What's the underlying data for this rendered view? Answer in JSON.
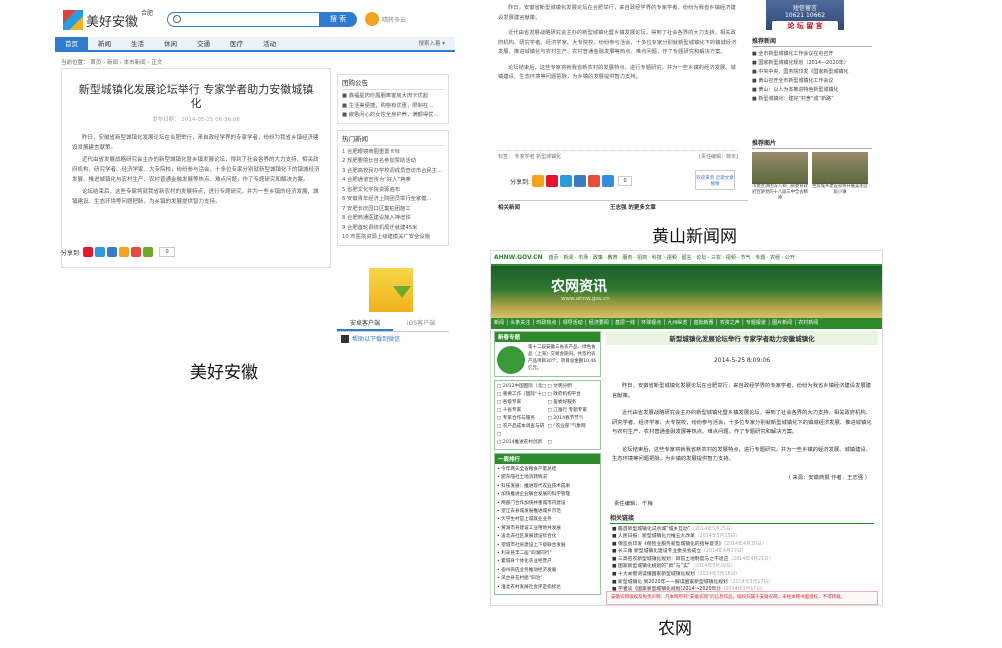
{
  "captions": {
    "meihao": "美好安徽",
    "huangshan": "黄山新闻网",
    "nongwang": "农网"
  },
  "meihao": {
    "logo": "美好安徽",
    "city": "合肥",
    "search_button": "搜 索",
    "weather": "晴转多云",
    "nav": [
      "首页",
      "新闻",
      "生活",
      "休闲",
      "交通",
      "医疗",
      "活动"
    ],
    "nav_right": "搜索入着 ▾",
    "breadcrumb": "当前位置： 首页 › 新闻 › 本市新闻 › 正文",
    "title": "新型城镇化发展论坛举行 专家学者助力安徽城镇化",
    "date": "发布日期： 2014-05-25 06:36:08",
    "paragraphs": [
      "昨日，安徽省新型城镇化发展论坛在合肥举行，来自政经学界的专家学者，纷纷为我省乡镇经济建设发展建言献策。",
      "近代由省发展战略研究会主办的新型城镇化暨乡镇发展论坛，得到了社会各界的大力支持，相关政府机构、研究学者、经济学家、大专院校，纷纷参与活会，十多位专家分别就新型城镇化下的镇城经济发展、推进城镇化与农村生产、农村普通金融发展等热点、难点问题，作了专题研究和解决方案。",
      "论坛结束后，这些专家将就我省新农村的发展特点，进行专题研究，并为一些乡镇的经济发展、城镇建设、生态环境等问题把脉，为乡镇的发展提供智力支持。"
    ],
    "share_label": "分享到:",
    "share_count": "0",
    "notice_title": "团购公告",
    "notices": [
      "■ 鑫福星肉价露胭离客房大肉卡优起",
      "■ 生活美便捷，购物有优惠，限制在...",
      "■ 疲惫闲心的女性全身护养，满额得优..."
    ],
    "hot_title": "热门新闻",
    "hot": [
      "1 合肥眼镜商圈重置卡标",
      "2 规肥要院长自名参加赞助活动",
      "3 合肥高校民办学校调成员查访市合民主...",
      "4 合肥通道宣传为“好人”蒋拳",
      "5 省肥文化学院资源遍布",
      "6 安徽青年经济上院团员举行全家健...",
      "7 安肥长庆园口区集拍团施工",
      "8 合肥商通医建设施入神增铁",
      "9 合肥首轮县统机局迁就建45米",
      "10 市医院资源上级建模关广安全设施"
    ],
    "tabs": [
      "安卓客户端",
      "iOS客户端"
    ],
    "download": "帮助以下载到微信"
  },
  "huangshan": {
    "paragraphs": [
      "昨日，安徽省新型城镇化发展论坛在合肥举行，来自政经学界的专家学者，纷纷为我省乡镇经济建设发展建言献策。",
      "近代由省发展战略研究会主办的新型城镇化暨乡镇发展论坛，得到了社会各界的大力支持，相关政府机构、研究学者、经济学家、大专院校，纷纷参与活会，十多位专家分别就新型城镇化下的镇城经济发展、推进城镇化与农村生产、农村普通金融发展等热点、难点问题，作了专题研究和解决方案。",
      "论坛结束后，这些专家将就我省新农村的发展特点，进行专题研究，并为一些乡镇的经济发展、城镇建设、生态环境等问题把脉，为乡镇的发展提供智力支持。"
    ],
    "tags": "标签： 专家学者 新型城镇化",
    "editor": "[责任编辑：荷米]",
    "share_label": "分享到:",
    "share_count": "0",
    "ad": "欢迎来到\n近期文章搜精",
    "related": "相关新闻",
    "more": "王志强 的更多文章",
    "msg_top": "短信留言",
    "msg_num": "10621 10662",
    "msg_btn": "论 坛 留 言",
    "rec_title": "推荐新闻",
    "rec": [
      "■ 全市新型城镇化工作会议在屯召开",
      "■ 国家新型城镇化规划（2014—2020年）",
      "■ 中央中央、国务院印发《国家新型城镇化",
      "■ 黄山召开全市新型城镇化工作会议",
      "■ 黄山：以人为本推进特色新型城镇化",
      "■ 新型城镇化：建好“村舍”成“新路”"
    ],
    "pic_title": "推荐图片",
    "pic_caps": [
      "市委宣讲团深入祁门县委县政府宣讲党的十八届三中全会精神",
      "住房城乡建设部将开展美丽宜居小镇"
    ]
  },
  "nongwang": {
    "site": "AHNW.GOV.CN",
    "top_links": "首页 · 新闻 · 市场 · 政策 · 教育 · 服务 · 招商 · 科技 · 视频 · 留言 · 论坛 · 三农 · 视频 · 节气 · 专题 · 农经 · 公开",
    "banner_title": "农网资讯",
    "banner_url": "www.ahnw.gov.cn",
    "nav": "新闻 │ 头条关注 │ 时政热点 │ 领导活动 │ 经济要闻 │ 基层一线 │ 环球视点 │ 九州纵览 │ 首批新惠 │ 农资之声 │ 专题报道 │ 图片新闻 │ 农村新闻",
    "left_box_title": "新春专题",
    "left_box_text": "第十二届安徽三省农产品、绿色食品（上海）交易会期间，共签约农产品项目30个，项目总金额10.46亿元。",
    "grid": [
      "□ 2012中国国际（北□",
      "□ 文明分明",
      "□ 重要工作（国际“十□",
      "□ 政府机构平台",
      "□ 各级专家",
      "□ 居委好服务",
      "□ 十省专家",
      "□ 江淮行 专题专家",
      "□ 专家合作与服务",
      "□ 2014春节节气",
      "□ 农产品成本调查与研□",
      "□ “农业部”气象网",
      "□ 2014推进农村创新",
      "□ "
    ],
    "rank_title": "一周排行",
    "rank": [
      "• 今年两天全省粮食产量总结",
      "• 肥东隔社土地流转情况",
      "• 科技发展：推进现代农业技术成果",
      "• 加快推进企业联合发展的科学管理",
      "• 两部门合作加快并重城市内建设",
      "• 望江去县城发展推进城乡示范",
      "• 大学生村官上城就业业务",
      "• 黄湖市县建设工业用地共发展",
      "• 凌北去社区发展建设综合化",
      "• 望城市社县建设上下级联合发展",
      "• 利辛县丰二届“四湖同行”",
      "• 霍城县个体化农业经营户",
      "• 宿州商店业务推动经济发展",
      "• 凤台县在村组“四治”",
      "• 淮北农村发展社会评定指标达"
    ],
    "title": "新型城镇化发展论坛举行 专家学者助力安徽城镇化",
    "date": "2014-5-25 8:09:06",
    "paragraphs": [
      "昨日，安徽省新型城镇化发展论坛在合肥举行，来自政经学界的专家学者，纷纷为我省乡镇经济建设发展建言献策。",
      "近代由省发展战略研究会主办的新型城镇化暨乡镇发展论坛，得到了社会各界的大力支持，相关政府机构、研究学者、经济学家、大专院校，纷纷参与活会，十多位专家分别就新型城镇化下的镇城经济发展、推进城镇化与农村生产、农村普通金融发展等热点、难点问题，作了专题研究和解决方案。",
      "论坛结束后，这些专家将就我省新农村的发展特点，进行专题研究，并为一些乡镇的经济发展、城镇建设、生态环境等问题把脉，为乡镇的发展提供智力支持。"
    ],
    "source": "（ 来源：安徽商报  作者：王志强 ）",
    "editor": "责任编辑： 千梅",
    "links_title": "相关链接",
    "links": [
      "■ 瞻首新型城镇化试点城“城乡互动”",
      "■ 人民日报：新型城镇化力推五大改革",
      "■ 保监会印发《保险业服务新型城镇化的指导意见》",
      "■ 长三角 新型城镇化建设专业委员会成立",
      "■ 三高密农新型城镇化规划：目前土地制度与之不适应",
      "■ 国家新型城镇化规划的“新”与“实”",
      "■ 十大关键词读懂国家新型城镇化规划",
      "■ 新型城镇化 到2020年——解读国家新型城镇化规划",
      "■ 学者谈《国家新型城镇化规划(2014～2020年)》",
      "■ 中国出台国家新型城镇化规划 到2020年城镇化率60%"
    ],
    "link_dates": [
      "（2014年5月25日）",
      "（2014年5月15日）",
      "（2014年4月30日）",
      "（2014年4月27日）",
      "（2014年4月21日）",
      "（2014年3月29日）",
      "（2014年3月18日）",
      "（2014年3月17日）",
      "（2014年3月17日）",
      "（2014年3月16日）"
    ],
    "copyright": "安徽农网版权及免责声明：凡本网所刊“安徽农网”的信息作品，版权归属于安徽农网，未经本网书面授权，不得转载。"
  }
}
